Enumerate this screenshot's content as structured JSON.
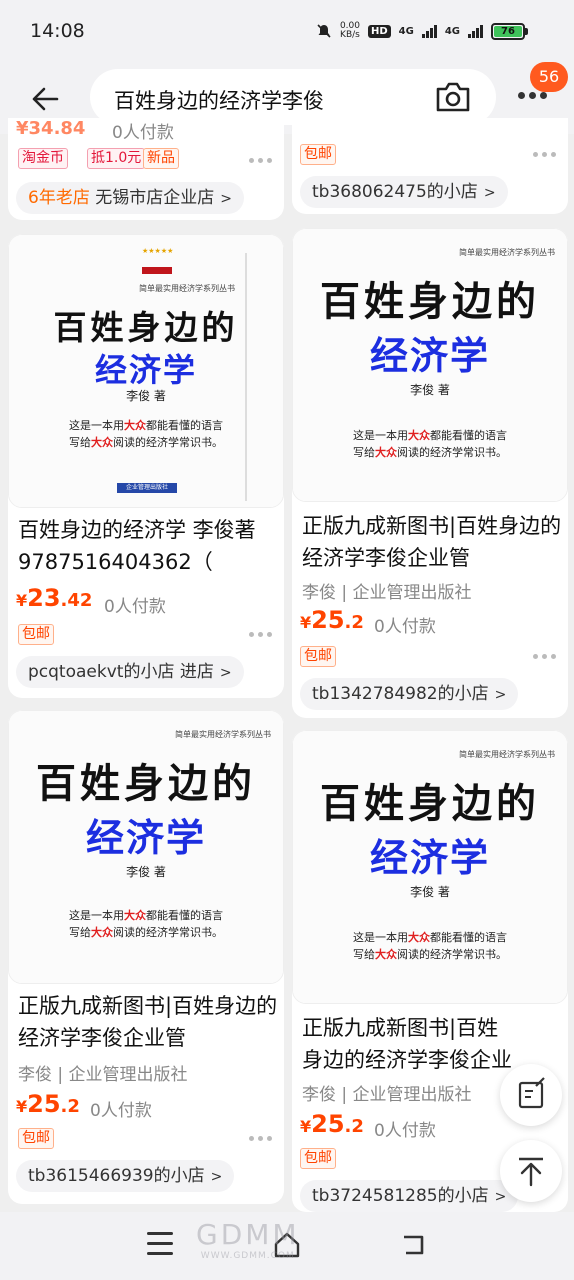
{
  "status_bar": {
    "time": "14:08",
    "net_speed": "0.00",
    "net_unit": "KB/s",
    "hd": "HD",
    "net1": "4G",
    "net2": "4G",
    "battery": "76"
  },
  "header": {
    "search_query": "百姓身边的经济学李俊",
    "badge_count": "56"
  },
  "left_column": {
    "partial_item": {
      "price_partial": "¥34.84",
      "paid": "0人付款",
      "tags": [
        "淘金币",
        "抵1.0元",
        "新品"
      ],
      "shop_age": "6年老店",
      "shop_name": "无锡市店企业店"
    },
    "items": [
      {
        "cover": {
          "series": "简单最实用经济学系列丛书",
          "title1": "百姓身边的",
          "title2": "经济学",
          "author": "李俊 著",
          "desc1_a": "这是一本用",
          "desc1_b": "大众",
          "desc1_c": "都能看懂的语言",
          "desc2_a": "写给",
          "desc2_b": "大众",
          "desc2_c": "阅读的经济学常识书。",
          "publisher": "企业管理出版社"
        },
        "title": "百姓身边的经济学 李俊著 9787516404362（",
        "price_yen": "¥",
        "price_int": "23",
        "price_dec": ".42",
        "paid": "0人付款",
        "tag": "包邮",
        "shop": "pcqtoaekvt的小店",
        "shop_action": "进店"
      },
      {
        "cover": {
          "series": "简单最实用经济学系列丛书",
          "title1": "百姓身边的",
          "title2": "经济学",
          "author": "李俊 著",
          "desc1_a": "这是一本用",
          "desc1_b": "大众",
          "desc1_c": "都能看懂的语言",
          "desc2_a": "写给",
          "desc2_b": "大众",
          "desc2_c": "阅读的经济学常识书。"
        },
        "title": "正版九成新图书|百姓身边的经济学李俊企业管",
        "subtitle": "李俊 | 企业管理出版社",
        "price_yen": "¥",
        "price_int": "25",
        "price_dec": ".2",
        "paid": "0人付款",
        "tag": "包邮",
        "shop": "tb3615466939的小店"
      }
    ]
  },
  "right_column": {
    "partial_item": {
      "tag": "包邮",
      "shop": "tb368062475的小店"
    },
    "items": [
      {
        "cover": {
          "series": "简单最实用经济学系列丛书",
          "title1": "百姓身边的",
          "title2": "经济学",
          "author": "李俊 著",
          "desc1_a": "这是一本用",
          "desc1_b": "大众",
          "desc1_c": "都能看懂的语言",
          "desc2_a": "写给",
          "desc2_b": "大众",
          "desc2_c": "阅读的经济学常识书。"
        },
        "title": "正版九成新图书|百姓身边的经济学李俊企业管",
        "subtitle": "李俊 | 企业管理出版社",
        "price_yen": "¥",
        "price_int": "25",
        "price_dec": ".2",
        "paid": "0人付款",
        "tag": "包邮",
        "shop": "tb1342784982的小店"
      },
      {
        "cover": {
          "series": "简单最实用经济学系列丛书",
          "title1": "百姓身边的",
          "title2": "经济学",
          "author": "李俊 著",
          "desc1_a": "这是一本用",
          "desc1_b": "大众",
          "desc1_c": "都能看懂的语言",
          "desc2_a": "写给",
          "desc2_b": "大众",
          "desc2_c": "阅读的经济学常识书。"
        },
        "title": "正版九成新图书|百姓身边的经济学李俊企业管",
        "subtitle": "李俊 | 企业管理出版社",
        "price_yen": "¥",
        "price_int": "25",
        "price_dec": ".2",
        "paid": "0人付款",
        "tag": "包邮",
        "shop": "tb3724581285的小店"
      }
    ]
  },
  "watermark": {
    "text": "GDMM",
    "url": "WWW.GDMM.COM"
  },
  "colors": {
    "accent": "#ff4400",
    "badge": "#ff5a1f",
    "cover_blue": "#1c2ee0"
  },
  "icons": {
    "back": "back-arrow-icon",
    "camera": "camera-icon",
    "more": "more-dots-icon",
    "note": "note-edit-icon",
    "top": "back-to-top-icon",
    "nav_menu": "menu-icon",
    "nav_home": "home-icon",
    "nav_back": "back-icon"
  }
}
